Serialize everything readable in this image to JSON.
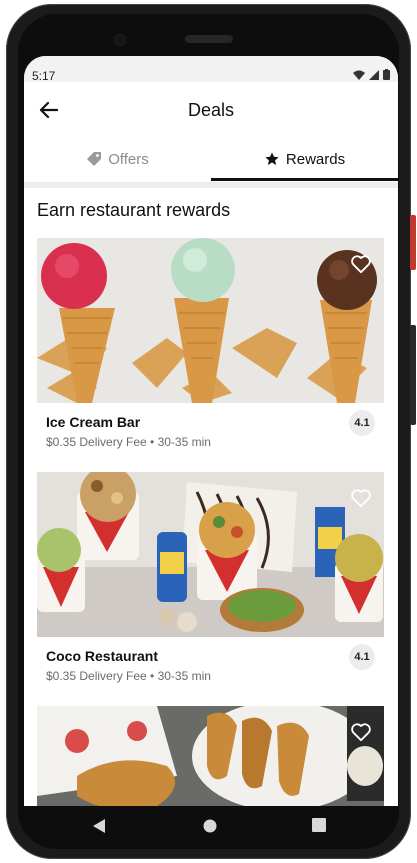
{
  "status_bar": {
    "time": "5:17"
  },
  "header": {
    "title": "Deals"
  },
  "tabs": [
    {
      "label": "Offers",
      "icon": "tag-icon",
      "selected": false
    },
    {
      "label": "Rewards",
      "icon": "star-icon",
      "selected": true
    }
  ],
  "section": {
    "title": "Earn restaurant rewards"
  },
  "restaurants": [
    {
      "name": "Ice Cream Bar",
      "meta": "$0.35 Delivery Fee • 30-35 min",
      "rating": "4.1"
    },
    {
      "name": "Coco Restaurant",
      "meta": "$0.35 Delivery Fee • 30-35 min",
      "rating": "4.1"
    },
    {
      "name": "",
      "meta": "",
      "rating": ""
    }
  ],
  "colors": {
    "accent": "#111111",
    "muted": "#8d8d8d",
    "rating_bg": "#ececec",
    "brand_red": "#d32f2f"
  }
}
